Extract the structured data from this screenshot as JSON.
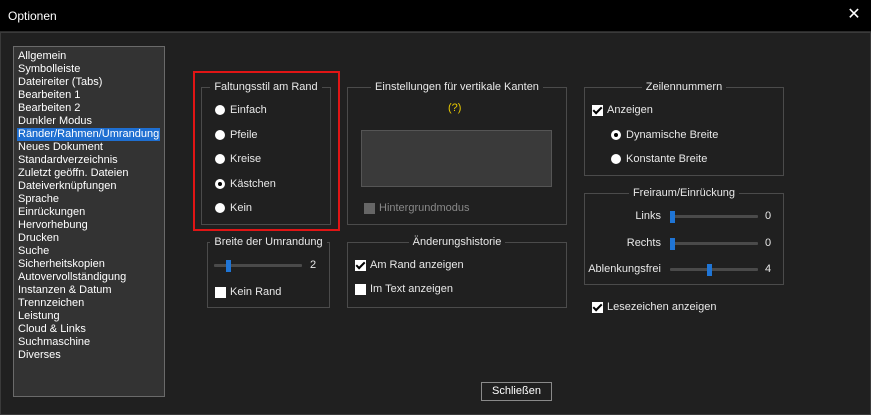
{
  "window": {
    "title": "Optionen",
    "close_glyph": "✕"
  },
  "nav": {
    "selected_index": 6,
    "items": [
      "Allgemein",
      "Symbolleiste",
      "Dateireiter (Tabs)",
      "Bearbeiten 1",
      "Bearbeiten 2",
      "Dunkler Modus",
      "Ränder/Rahmen/Umrandung",
      "Neues Dokument",
      "Standardverzeichnis",
      "Zuletzt geöffn. Dateien",
      "Dateiverknüpfungen",
      "Sprache",
      "Einrückungen",
      "Hervorhebung",
      "Drucken",
      "Suche",
      "Sicherheitskopien",
      "Autovervollständigung",
      "Instanzen & Datum",
      "Trennzeichen",
      "Leistung",
      "Cloud & Links",
      "Suchmaschine",
      "Diverses"
    ]
  },
  "folding": {
    "legend": "Faltungsstil am Rand",
    "options": [
      {
        "label": "Einfach",
        "selected": false
      },
      {
        "label": "Pfeile",
        "selected": false
      },
      {
        "label": "Kreise",
        "selected": false
      },
      {
        "label": "Kästchen",
        "selected": true
      },
      {
        "label": "Kein",
        "selected": false
      }
    ]
  },
  "border_width": {
    "legend": "Breite der Umrandung",
    "value": "2",
    "level": 0.1,
    "no_border_label": "Kein Rand",
    "no_border_checked": false
  },
  "vertical_edges": {
    "legend": "Einstellungen für vertikale Kanten",
    "hint": "(?)",
    "background_mode_label": "Hintergrundmodus",
    "background_mode_checked": false
  },
  "history": {
    "legend": "Änderungshistorie",
    "options": [
      {
        "label": "Am Rand anzeigen",
        "checked": true
      },
      {
        "label": "Im Text anzeigen",
        "checked": false
      }
    ]
  },
  "line_numbers": {
    "legend": "Zeilennummern",
    "show_label": "Anzeigen",
    "show_checked": true,
    "options": [
      {
        "label": "Dynamische Breite",
        "selected": true
      },
      {
        "label": "Konstante Breite",
        "selected": false
      }
    ]
  },
  "padding": {
    "legend": "Freiraum/Einrückung",
    "sliders": [
      {
        "label": "Links",
        "value": "0",
        "level": 0
      },
      {
        "label": "Rechts",
        "value": "0",
        "level": 0
      },
      {
        "label": "Ablenkungsfrei",
        "value": "4",
        "level": 0.45
      }
    ]
  },
  "bookmarks": {
    "label": "Lesezeichen anzeigen",
    "checked": true
  },
  "close_button": {
    "label": "Schließen"
  },
  "colors": {
    "accent": "#1f75d6",
    "highlight_box": "#e01515",
    "hint": "#e6c800"
  }
}
